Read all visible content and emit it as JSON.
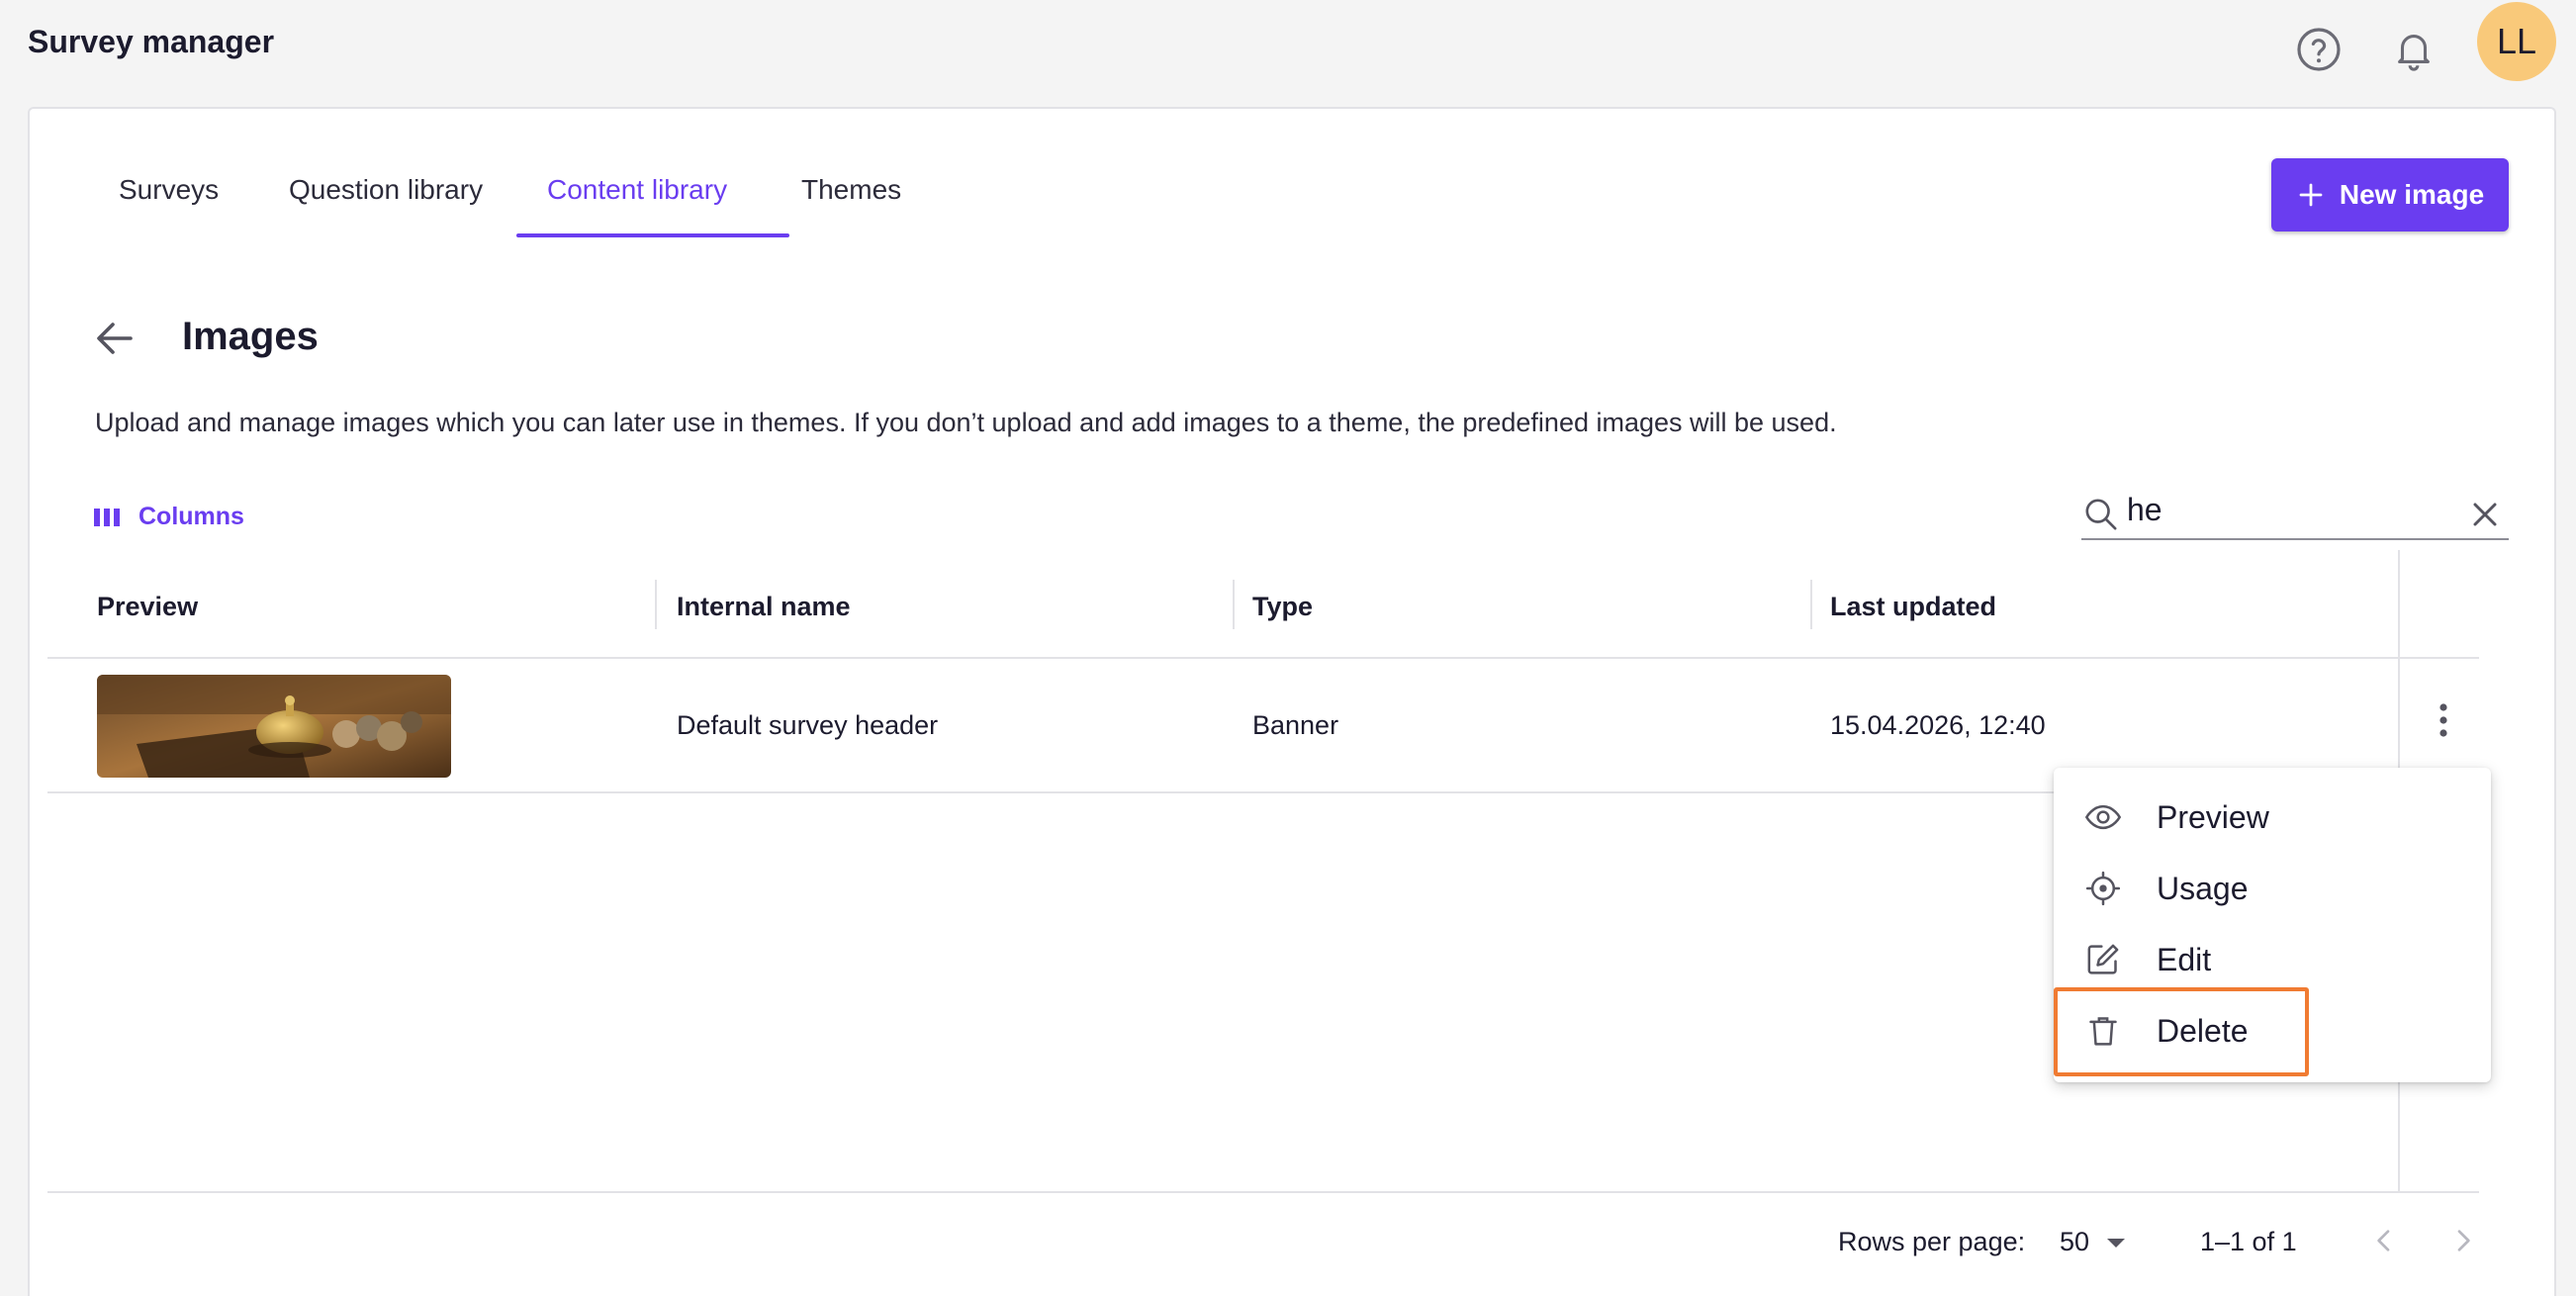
{
  "app": {
    "title": "Survey manager"
  },
  "header": {
    "avatar_initials": "LL"
  },
  "tabs": [
    {
      "label": "Surveys"
    },
    {
      "label": "Question library"
    },
    {
      "label": "Content library",
      "active": true
    },
    {
      "label": "Themes"
    }
  ],
  "actions": {
    "new_image_label": "New image"
  },
  "page": {
    "title": "Images",
    "description": "Upload and manage images which you can later use in themes. If you don’t upload and add images to a theme, the predefined images will be used."
  },
  "toolbar": {
    "columns_label": "Columns"
  },
  "search": {
    "value": "he",
    "placeholder": ""
  },
  "table": {
    "headers": [
      "Preview",
      "Internal name",
      "Type",
      "Last updated"
    ],
    "rows": [
      {
        "internal_name": "Default survey header",
        "type": "Banner",
        "last_updated": "15.04.2026, 12:40"
      }
    ]
  },
  "row_menu": {
    "items": [
      {
        "label": "Preview",
        "icon": "eye-icon"
      },
      {
        "label": "Usage",
        "icon": "target-icon"
      },
      {
        "label": "Edit",
        "icon": "edit-icon"
      },
      {
        "label": "Delete",
        "icon": "trash-icon",
        "highlighted": true
      }
    ]
  },
  "pagination": {
    "rows_per_page_label": "Rows per page:",
    "rows_per_page": "50",
    "range": "1–1 of 1"
  },
  "colors": {
    "accent": "#6a3df0",
    "avatar": "#f9c97a",
    "highlight": "#f07b32"
  }
}
